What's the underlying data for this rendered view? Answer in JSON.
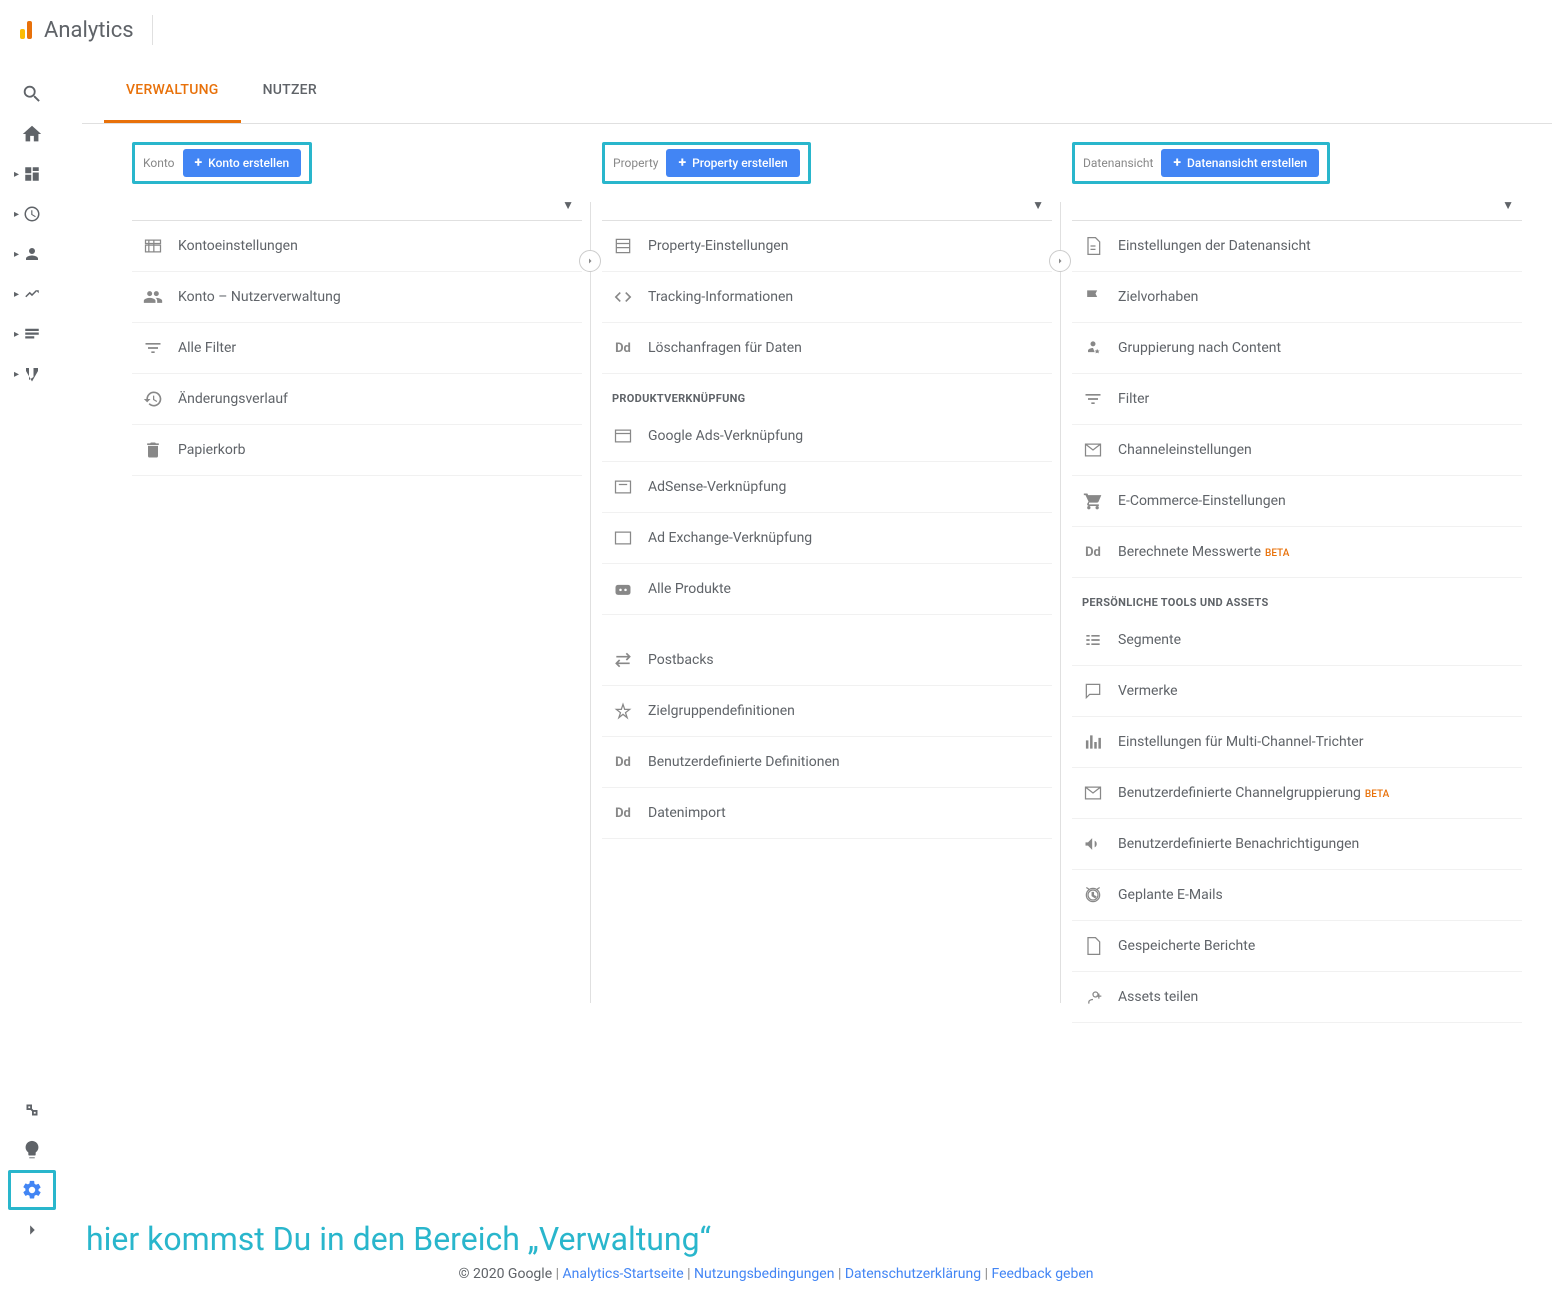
{
  "header": {
    "app": "Analytics"
  },
  "tabs": {
    "admin": "VERWALTUNG",
    "users": "NUTZER"
  },
  "account": {
    "label": "Konto",
    "create": "Konto erstellen",
    "items": [
      {
        "label": "Kontoeinstellungen"
      },
      {
        "label": "Konto – Nutzerverwaltung"
      },
      {
        "label": "Alle Filter"
      },
      {
        "label": "Änderungsverlauf"
      },
      {
        "label": "Papierkorb"
      }
    ]
  },
  "property": {
    "label": "Property",
    "create": "Property erstellen",
    "items": [
      {
        "label": "Property-Einstellungen"
      },
      {
        "label": "Tracking-Informationen"
      },
      {
        "label": "Löschanfragen für Daten"
      }
    ],
    "section_product": "PRODUKTVERKNÜPFUNG",
    "product_items": [
      {
        "label": "Google Ads-Verknüpfung"
      },
      {
        "label": "AdSense-Verknüpfung"
      },
      {
        "label": "Ad Exchange-Verknüpfung"
      },
      {
        "label": "Alle Produkte"
      }
    ],
    "more_items": [
      {
        "label": "Postbacks"
      },
      {
        "label": "Zielgruppendefinitionen"
      },
      {
        "label": "Benutzerdefinierte Definitionen"
      },
      {
        "label": "Datenimport"
      }
    ]
  },
  "view": {
    "label": "Datenansicht",
    "create": "Datenansicht erstellen",
    "items": [
      {
        "label": "Einstellungen der Datenansicht"
      },
      {
        "label": "Zielvorhaben"
      },
      {
        "label": "Gruppierung nach Content"
      },
      {
        "label": "Filter"
      },
      {
        "label": "Channeleinstellungen"
      },
      {
        "label": "E-Commerce-Einstellungen"
      },
      {
        "label": "Berechnete Messwerte",
        "beta": "BETA"
      }
    ],
    "section_personal": "PERSÖNLICHE TOOLS UND ASSETS",
    "personal_items": [
      {
        "label": "Segmente"
      },
      {
        "label": "Vermerke"
      },
      {
        "label": "Einstellungen für Multi-Channel-Trichter"
      },
      {
        "label": "Benutzerdefinierte Channelgruppierung",
        "beta": "BETA"
      },
      {
        "label": "Benutzerdefinierte Benachrichtigungen"
      },
      {
        "label": "Geplante E-Mails"
      },
      {
        "label": "Gespeicherte Berichte"
      },
      {
        "label": "Assets teilen"
      }
    ]
  },
  "annotation": "hier kommst Du in den Bereich „Verwaltung“",
  "footer": {
    "copyright": "© 2020 Google",
    "links": {
      "home": "Analytics-Startseite",
      "terms": "Nutzungsbedingungen",
      "privacy": "Datenschutzerklärung",
      "feedback": "Feedback geben"
    }
  }
}
